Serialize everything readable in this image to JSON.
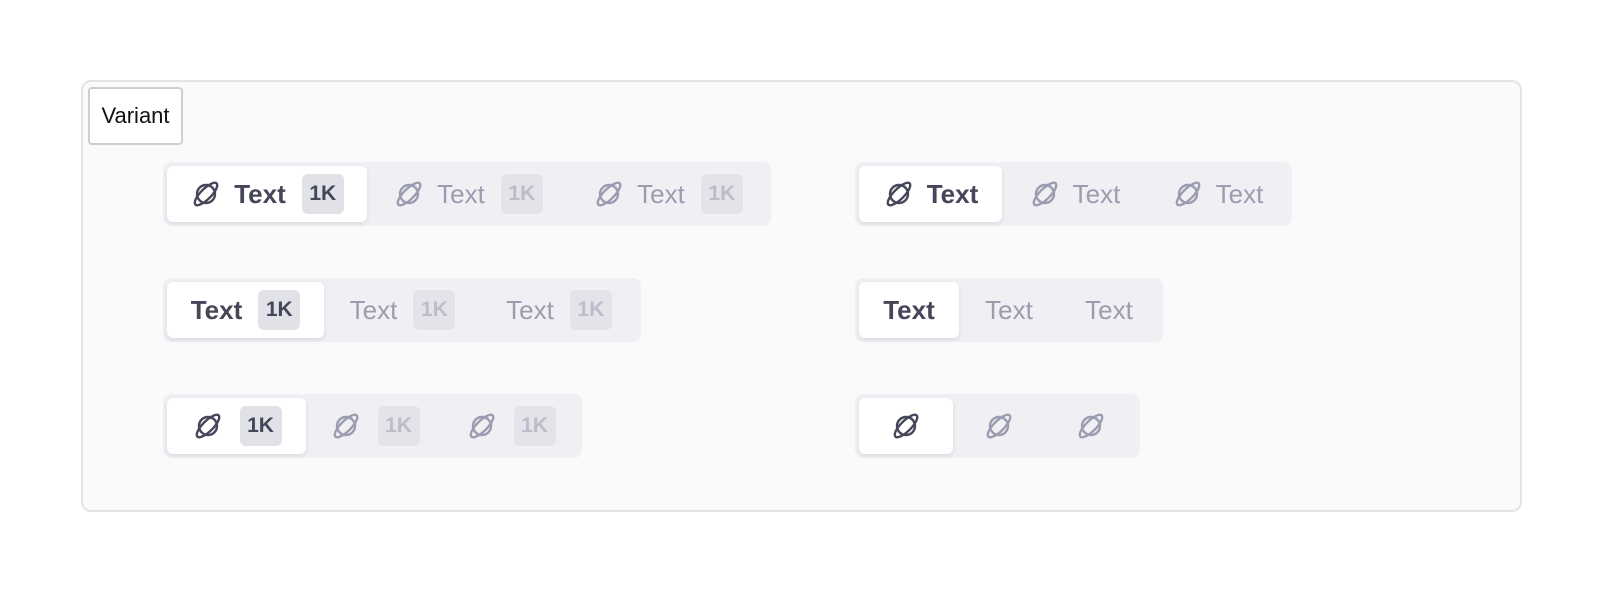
{
  "variant_label": "Variant",
  "colors": {
    "active_text": "#454659",
    "inactive_text": "#9b9caf",
    "group_background": "#efeff4",
    "active_background": "#ffffff"
  },
  "icon_name": "planet-icon",
  "rows": {
    "icon_text_badge": [
      {
        "text": "Text",
        "badge": "1K",
        "active": true
      },
      {
        "text": "Text",
        "badge": "1K",
        "active": false
      },
      {
        "text": "Text",
        "badge": "1K",
        "active": false
      }
    ],
    "icon_text": [
      {
        "text": "Text",
        "active": true
      },
      {
        "text": "Text",
        "active": false
      },
      {
        "text": "Text",
        "active": false
      }
    ],
    "text_badge": [
      {
        "text": "Text",
        "badge": "1K",
        "active": true
      },
      {
        "text": "Text",
        "badge": "1K",
        "active": false
      },
      {
        "text": "Text",
        "badge": "1K",
        "active": false
      }
    ],
    "text_only": [
      {
        "text": "Text",
        "active": true
      },
      {
        "text": "Text",
        "active": false
      },
      {
        "text": "Text",
        "active": false
      }
    ],
    "icon_badge": [
      {
        "badge": "1K",
        "active": true
      },
      {
        "badge": "1K",
        "active": false
      },
      {
        "badge": "1K",
        "active": false
      }
    ],
    "icon_only": [
      {
        "active": true
      },
      {
        "active": false
      },
      {
        "active": false
      }
    ]
  }
}
